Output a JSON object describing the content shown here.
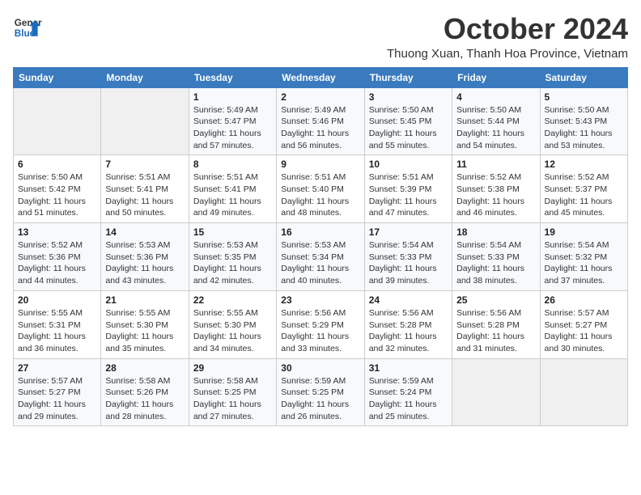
{
  "header": {
    "logo_line1": "General",
    "logo_line2": "Blue",
    "title": "October 2024",
    "subtitle": "Thuong Xuan, Thanh Hoa Province, Vietnam"
  },
  "columns": [
    "Sunday",
    "Monday",
    "Tuesday",
    "Wednesday",
    "Thursday",
    "Friday",
    "Saturday"
  ],
  "weeks": [
    [
      {
        "day": "",
        "empty": true
      },
      {
        "day": "",
        "empty": true
      },
      {
        "day": "1",
        "sunrise": "5:49 AM",
        "sunset": "5:47 PM",
        "daylight": "11 hours and 57 minutes."
      },
      {
        "day": "2",
        "sunrise": "5:49 AM",
        "sunset": "5:46 PM",
        "daylight": "11 hours and 56 minutes."
      },
      {
        "day": "3",
        "sunrise": "5:50 AM",
        "sunset": "5:45 PM",
        "daylight": "11 hours and 55 minutes."
      },
      {
        "day": "4",
        "sunrise": "5:50 AM",
        "sunset": "5:44 PM",
        "daylight": "11 hours and 54 minutes."
      },
      {
        "day": "5",
        "sunrise": "5:50 AM",
        "sunset": "5:43 PM",
        "daylight": "11 hours and 53 minutes."
      }
    ],
    [
      {
        "day": "6",
        "sunrise": "5:50 AM",
        "sunset": "5:42 PM",
        "daylight": "11 hours and 51 minutes."
      },
      {
        "day": "7",
        "sunrise": "5:51 AM",
        "sunset": "5:41 PM",
        "daylight": "11 hours and 50 minutes."
      },
      {
        "day": "8",
        "sunrise": "5:51 AM",
        "sunset": "5:41 PM",
        "daylight": "11 hours and 49 minutes."
      },
      {
        "day": "9",
        "sunrise": "5:51 AM",
        "sunset": "5:40 PM",
        "daylight": "11 hours and 48 minutes."
      },
      {
        "day": "10",
        "sunrise": "5:51 AM",
        "sunset": "5:39 PM",
        "daylight": "11 hours and 47 minutes."
      },
      {
        "day": "11",
        "sunrise": "5:52 AM",
        "sunset": "5:38 PM",
        "daylight": "11 hours and 46 minutes."
      },
      {
        "day": "12",
        "sunrise": "5:52 AM",
        "sunset": "5:37 PM",
        "daylight": "11 hours and 45 minutes."
      }
    ],
    [
      {
        "day": "13",
        "sunrise": "5:52 AM",
        "sunset": "5:36 PM",
        "daylight": "11 hours and 44 minutes."
      },
      {
        "day": "14",
        "sunrise": "5:53 AM",
        "sunset": "5:36 PM",
        "daylight": "11 hours and 43 minutes."
      },
      {
        "day": "15",
        "sunrise": "5:53 AM",
        "sunset": "5:35 PM",
        "daylight": "11 hours and 42 minutes."
      },
      {
        "day": "16",
        "sunrise": "5:53 AM",
        "sunset": "5:34 PM",
        "daylight": "11 hours and 40 minutes."
      },
      {
        "day": "17",
        "sunrise": "5:54 AM",
        "sunset": "5:33 PM",
        "daylight": "11 hours and 39 minutes."
      },
      {
        "day": "18",
        "sunrise": "5:54 AM",
        "sunset": "5:33 PM",
        "daylight": "11 hours and 38 minutes."
      },
      {
        "day": "19",
        "sunrise": "5:54 AM",
        "sunset": "5:32 PM",
        "daylight": "11 hours and 37 minutes."
      }
    ],
    [
      {
        "day": "20",
        "sunrise": "5:55 AM",
        "sunset": "5:31 PM",
        "daylight": "11 hours and 36 minutes."
      },
      {
        "day": "21",
        "sunrise": "5:55 AM",
        "sunset": "5:30 PM",
        "daylight": "11 hours and 35 minutes."
      },
      {
        "day": "22",
        "sunrise": "5:55 AM",
        "sunset": "5:30 PM",
        "daylight": "11 hours and 34 minutes."
      },
      {
        "day": "23",
        "sunrise": "5:56 AM",
        "sunset": "5:29 PM",
        "daylight": "11 hours and 33 minutes."
      },
      {
        "day": "24",
        "sunrise": "5:56 AM",
        "sunset": "5:28 PM",
        "daylight": "11 hours and 32 minutes."
      },
      {
        "day": "25",
        "sunrise": "5:56 AM",
        "sunset": "5:28 PM",
        "daylight": "11 hours and 31 minutes."
      },
      {
        "day": "26",
        "sunrise": "5:57 AM",
        "sunset": "5:27 PM",
        "daylight": "11 hours and 30 minutes."
      }
    ],
    [
      {
        "day": "27",
        "sunrise": "5:57 AM",
        "sunset": "5:27 PM",
        "daylight": "11 hours and 29 minutes."
      },
      {
        "day": "28",
        "sunrise": "5:58 AM",
        "sunset": "5:26 PM",
        "daylight": "11 hours and 28 minutes."
      },
      {
        "day": "29",
        "sunrise": "5:58 AM",
        "sunset": "5:25 PM",
        "daylight": "11 hours and 27 minutes."
      },
      {
        "day": "30",
        "sunrise": "5:59 AM",
        "sunset": "5:25 PM",
        "daylight": "11 hours and 26 minutes."
      },
      {
        "day": "31",
        "sunrise": "5:59 AM",
        "sunset": "5:24 PM",
        "daylight": "11 hours and 25 minutes."
      },
      {
        "day": "",
        "empty": true
      },
      {
        "day": "",
        "empty": true
      }
    ]
  ]
}
